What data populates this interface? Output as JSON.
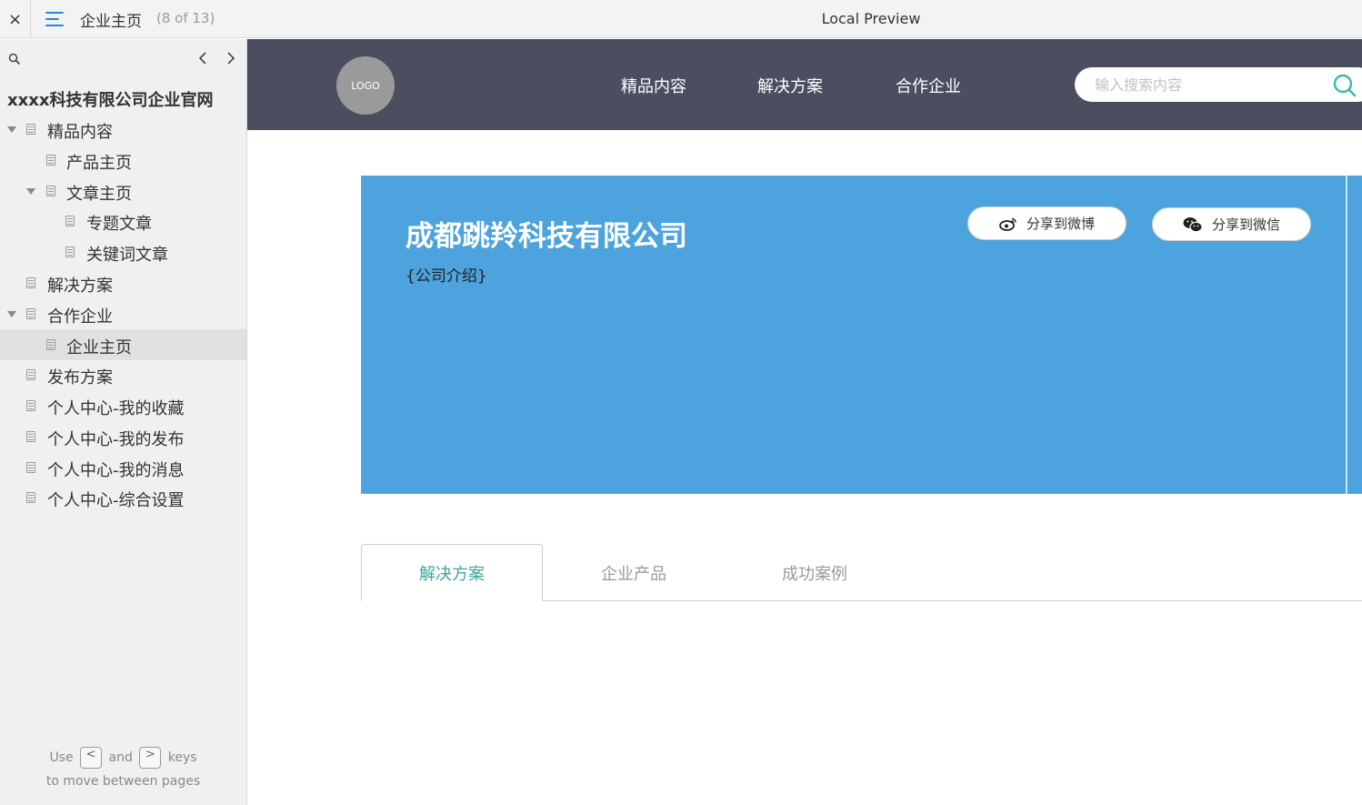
{
  "topbar": {
    "close_label": "×",
    "page_title": "企业主页",
    "page_count": "(8 of 13)",
    "preview_title": "Local Preview"
  },
  "sidebar": {
    "site_title": "xxxx科技有限公司企业官网",
    "items": [
      {
        "label": "精品内容"
      },
      {
        "label": "产品主页"
      },
      {
        "label": "文章主页"
      },
      {
        "label": "专题文章"
      },
      {
        "label": "关键词文章"
      },
      {
        "label": "解决方案"
      },
      {
        "label": "合作企业"
      },
      {
        "label": "企业主页"
      },
      {
        "label": "发布方案"
      },
      {
        "label": "个人中心-我的收藏"
      },
      {
        "label": "个人中心-我的发布"
      },
      {
        "label": "个人中心-我的消息"
      },
      {
        "label": "个人中心-综合设置"
      }
    ],
    "active_item": "企业主页",
    "hint": {
      "use": "Use",
      "and": "and",
      "keys": "keys",
      "line2": "to move between pages",
      "key_prev": "<",
      "key_next": ">"
    }
  },
  "site": {
    "logo": "LOGO",
    "nav": [
      "精品内容",
      "解决方案",
      "合作企业"
    ],
    "search_placeholder": "输入搜索内容",
    "company_name": "成都跳羚科技有限公司",
    "company_intro": "{公司介绍}",
    "share_weibo": "分享到微博",
    "share_wechat": "分享到微信",
    "tabs": [
      "解决方案",
      "企业产品",
      "成功案例"
    ],
    "active_tab": "解决方案"
  },
  "colors": {
    "header_bg": "#4a4e5f",
    "banner_bg": "#4ca3dd",
    "accent_teal": "#3aa89a",
    "menu_blue": "#1f8ad6"
  }
}
